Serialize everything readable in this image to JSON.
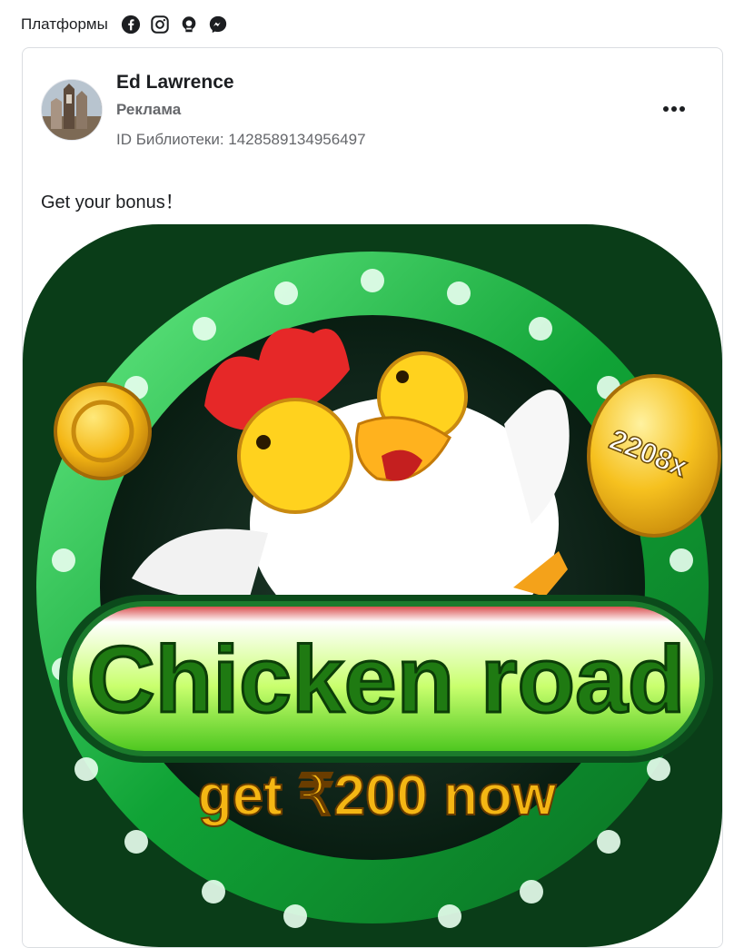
{
  "platforms": {
    "label": "Платформы",
    "icons": [
      "facebook-icon",
      "instagram-icon",
      "audience-network-icon",
      "messenger-icon"
    ]
  },
  "ad": {
    "advertiser": "Ed Lawrence",
    "sponsored": "Реклама",
    "library_id": "ID Библиотеки: 1428589134956497",
    "caption": "Get your bonus！",
    "creative": {
      "title": "Chicken road",
      "cta": "get ₹200 now",
      "multiplier": "2208x"
    }
  },
  "colors": {
    "text": "#1c1e21",
    "secondary": "#65676b",
    "ring": "#19b33c",
    "gold": "#f4b614",
    "comb": "#e62828"
  }
}
